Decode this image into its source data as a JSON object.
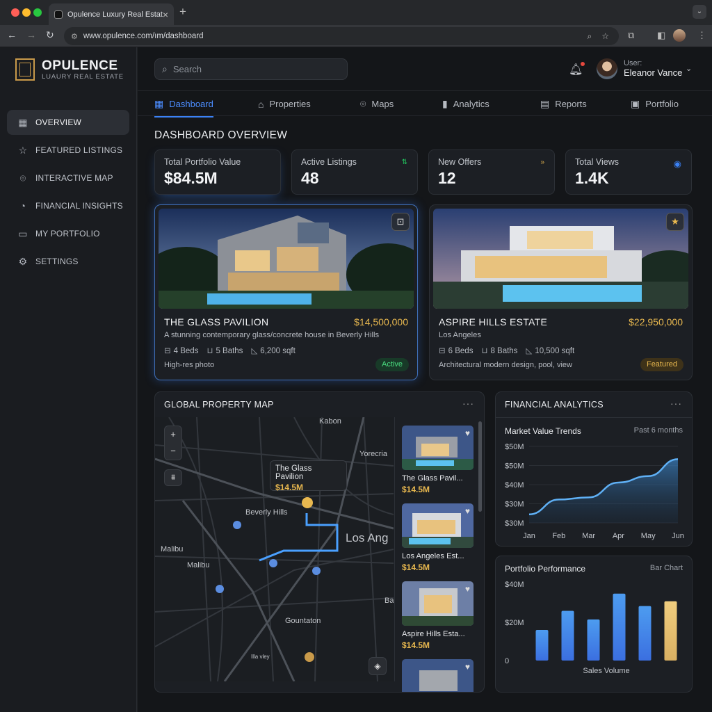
{
  "browser": {
    "tab_title": "Opulence Luxury Real Estat",
    "url": "www.opulence.com/ım/dashboard"
  },
  "brand": {
    "name": "OPULENCE",
    "tagline": "LUAURY REAL ESTATE"
  },
  "sidebar": {
    "items": [
      {
        "label": "OVERVIEW",
        "icon": "grid-icon",
        "active": true
      },
      {
        "label": "FEATURED LISTINGS",
        "icon": "star-icon"
      },
      {
        "label": "INTERACTIVE MAP",
        "icon": "map-pin-icon"
      },
      {
        "label": "FINANCIAL INSIGHTS",
        "icon": "pie-chart-icon"
      },
      {
        "label": "MY PORTFOLIO",
        "icon": "folder-icon"
      },
      {
        "label": "SETTINGS",
        "icon": "gear-icon"
      }
    ]
  },
  "header": {
    "search_placeholder": "Search",
    "user_label": "User:",
    "user_name": "Eleanor Vance"
  },
  "topnav": [
    {
      "label": "Dashboard",
      "active": true
    },
    {
      "label": "Properties"
    },
    {
      "label": "Maps"
    },
    {
      "label": "Analytics"
    },
    {
      "label": "Reports"
    },
    {
      "label": "Portfolio"
    }
  ],
  "page_title": "DASHBOARD OVERVIEW",
  "stats": [
    {
      "label": "Total Portfolio Value",
      "value": "$84.5M"
    },
    {
      "label": "Active Listings",
      "value": "48",
      "icon_color": "#22c55e"
    },
    {
      "label": "New Offers",
      "value": "12",
      "icon_color": "#e8b84f"
    },
    {
      "label": "Total Views",
      "value": "1.4K",
      "icon_color": "#3b82f6"
    }
  ],
  "properties": [
    {
      "title": "THE GLASS PAVILION",
      "price": "$14,500,000",
      "desc": "A stunning contemporary glass/concrete house in Beverly Hills",
      "beds": "4 Beds",
      "baths": "5 Baths",
      "sqft": "6,200 sqft",
      "note": "High-res photo",
      "status": "Active"
    },
    {
      "title": "ASPIRE HILLS ESTATE",
      "price": "$22,950,000",
      "desc": "Los Angeles",
      "beds": "6 Beds",
      "baths": "8 Baths",
      "sqft": "10,500 sqft",
      "note": "Architectural modern design, pool, view",
      "status": "Featured"
    }
  ],
  "map_panel": {
    "title": "GLOBAL PROPERTY MAP",
    "tooltip_name": "The Glass Pavilion",
    "tooltip_price": "$14.5M",
    "labels": {
      "kabon": "Kabon",
      "yorecria": "Yorecria",
      "beverly": "Beverly Hills",
      "losang": "Los Ang",
      "malibu1": "Malibu",
      "malibu2": "Malibu",
      "bap": "Bap",
      "gountaton": "Gountaton",
      "wlvey": "Ιlla vley"
    },
    "listings": [
      {
        "name": "The Glass Pavil...",
        "price": "$14.5M"
      },
      {
        "name": "Los Angeles Est...",
        "price": "$14.5M"
      },
      {
        "name": "Aspire Hills Esta...",
        "price": "$14.5M"
      }
    ]
  },
  "financial": {
    "title": "FINANCIAL ANALYTICS",
    "trend_title": "Market Value Trends",
    "trend_note": "Past 6 months",
    "perf_title": "Portfolio Performance",
    "perf_note": "Bar Chart"
  },
  "chart_data": [
    {
      "type": "area",
      "title": "Market Value Trends",
      "categories": [
        "Jan",
        "Feb",
        "Mar",
        "Apr",
        "May",
        "Jun"
      ],
      "y_tick_labels": [
        "$50M",
        "$50M",
        "$40M",
        "$30M",
        "$30M"
      ],
      "values": [
        26,
        33,
        34,
        41,
        44,
        52
      ],
      "ylim": [
        22,
        58
      ]
    },
    {
      "type": "bar",
      "title": "Portfolio Performance",
      "xlabel": "Sales Volume",
      "y_tick_labels": [
        "$40M",
        "$20M",
        "0"
      ],
      "values": [
        16,
        26,
        21.5,
        35,
        28.5,
        31
      ],
      "ylim": [
        0,
        40
      ],
      "colors": [
        "#3b6fe0",
        "#3b6fe0",
        "#3b6fe0",
        "#3b6fe0",
        "#3b6fe0",
        "#d9b062"
      ]
    }
  ]
}
